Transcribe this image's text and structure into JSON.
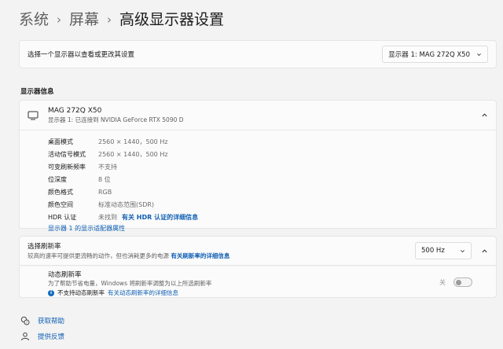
{
  "breadcrumb": {
    "items": [
      "系统",
      "屏幕"
    ],
    "current": "高级显示器设置"
  },
  "selector": {
    "label": "选择一个显示器以查看或更改其设置",
    "selected": "显示器 1: MAG 272Q X50"
  },
  "section_title": "显示器信息",
  "monitor": {
    "name": "MAG 272Q X50",
    "subtitle": "显示器 1: 已连接到 NVIDIA GeForce RTX 5090 D",
    "rows": [
      {
        "label": "桌面模式",
        "value": "2560 × 1440，500 Hz"
      },
      {
        "label": "活动信号模式",
        "value": "2560 × 1440，500 Hz"
      },
      {
        "label": "可变刷新频率",
        "value": "不支持"
      },
      {
        "label": "位深度",
        "value": "8 位"
      },
      {
        "label": "颜色格式",
        "value": "RGB"
      },
      {
        "label": "颜色空间",
        "value": "标准动态范围(SDR)"
      },
      {
        "label": "HDR 认证",
        "value": "未找到",
        "link": "有关 HDR 认证的详细信息"
      }
    ],
    "adapter_link": "显示器 1 的显示适配器属性"
  },
  "refresh": {
    "title": "选择刷新率",
    "desc": "较高的速率可提供更流畅的动作，但也消耗更多的电源",
    "desc_link": "有关刷新率的详细信息",
    "value": "500 Hz"
  },
  "dynamic": {
    "title": "动态刷新率",
    "desc": "为了帮助节省电量，Windows 将刷新率调整为以上所选刷新率",
    "note": "不支持动态刷新率",
    "note_link": "有关动态刷新率的详细信息",
    "toggle_label": "关",
    "toggle_on": false
  },
  "footer": {
    "help": "获取帮助",
    "feedback": "提供反馈"
  },
  "colors": {
    "accent": "#0f5fb4",
    "background": "#f3f3f3",
    "card": "#fbfbfb"
  }
}
